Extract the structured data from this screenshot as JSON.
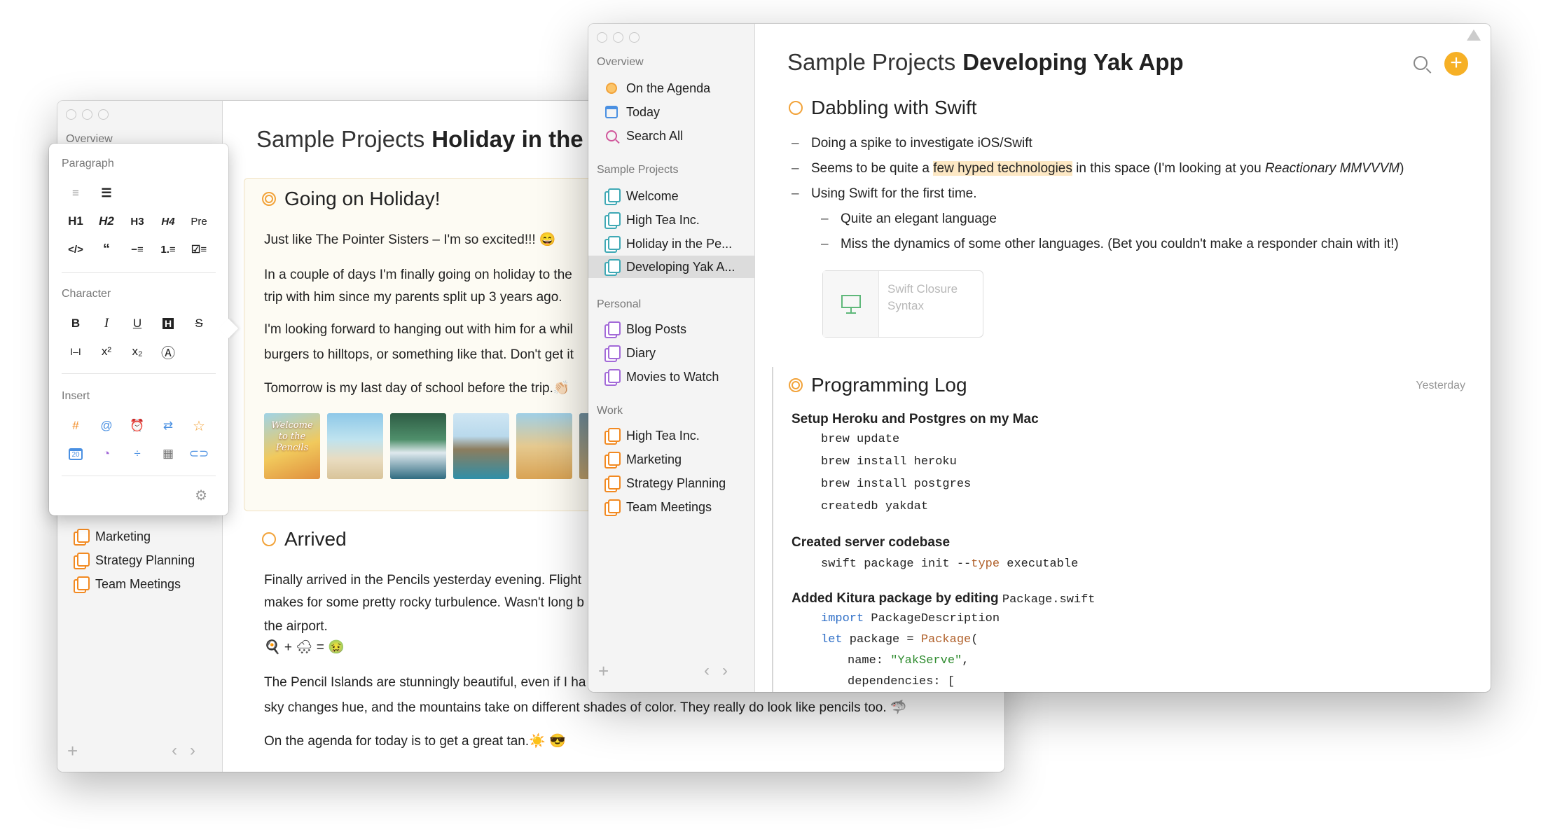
{
  "back_window": {
    "sidebar": {
      "overview_label": "Overview",
      "items": [
        {
          "label": "Marketing"
        },
        {
          "label": "Strategy Planning"
        },
        {
          "label": "Team Meetings"
        }
      ]
    },
    "title": {
      "light": "Sample Projects",
      "bold": "Holiday in the Pencil"
    },
    "sections": [
      {
        "heading": "Going on Holiday!",
        "paragraphs": [
          "Just like The Pointer Sisters – I'm so excited!!! 😄",
          "In a couple of days I'm finally going on holiday to the",
          "trip with him since my parents split up 3 years ago.",
          "I'm looking forward to hanging out with him for a whil",
          "burgers to hilltops, or something like that. Don't get it",
          "Tomorrow is my last day of school before the trip.👏🏻"
        ]
      },
      {
        "heading": "Arrived",
        "paragraphs": [
          "Finally arrived in the Pencils yesterday evening. Flight",
          "makes for some pretty rocky turbulence. Wasn't long b",
          "the airport.",
          "🍳 + 🌨 = 🤢",
          "The Pencil Islands are stunningly beautiful, even if I ha",
          "sky changes hue, and the mountains take on different shades of color. They really do look like pencils too. 🦈",
          "On the agenda for today is to get a great tan.☀️ 😎"
        ]
      }
    ],
    "photo_caption": "Welcome to the Pencils"
  },
  "format_popover": {
    "paragraph_label": "Paragraph",
    "paragraph_row1": [
      "≡",
      "☰"
    ],
    "paragraph_row2": [
      "H1",
      "H2",
      "H3",
      "H4",
      "Pre"
    ],
    "paragraph_row3": [
      "</>",
      "“",
      "−≡",
      "1.≡",
      "☑≡"
    ],
    "character_label": "Character",
    "character_row1": [
      "B",
      "I",
      "U",
      "H",
      "S"
    ],
    "character_row2": [
      "I–I",
      "x²",
      "x₂",
      "Ⓐ"
    ],
    "insert_label": "Insert",
    "insert_row1": [
      "#",
      "@",
      "⏰",
      "⇄",
      "☆"
    ],
    "insert_row2": [
      "20",
      "◔",
      "÷",
      "▦",
      "⊂⊃"
    ]
  },
  "front_window": {
    "sidebar": {
      "overview_label": "Overview",
      "overview_items": [
        "On the Agenda",
        "Today",
        "Search All"
      ],
      "sample_label": "Sample Projects",
      "sample_items": [
        "Welcome",
        "High Tea Inc.",
        "Holiday in the Pe...",
        "Developing Yak A..."
      ],
      "personal_label": "Personal",
      "personal_items": [
        "Blog Posts",
        "Diary",
        "Movies to Watch"
      ],
      "work_label": "Work",
      "work_items": [
        "High Tea Inc.",
        "Marketing",
        "Strategy Planning",
        "Team Meetings"
      ]
    },
    "title": {
      "light": "Sample Projects",
      "bold": "Developing Yak App"
    },
    "dabbling": {
      "heading": "Dabbling with Swift",
      "b1": "Doing a spike to investigate iOS/Swift",
      "b2_pre": "Seems to be quite a ",
      "b2_hl": "few hyped technologies",
      "b2_post": " in this space (I'm looking at you ",
      "b2_em": "Reactionary MMVVVM",
      "b2_end": ")",
      "b3": "Using Swift for the first time.",
      "b3a": "Quite an elegant language",
      "b3b": "Miss the dynamics of some other languages. (Bet you couldn't make a responder chain with it!)",
      "card_line1": "Swift Closure",
      "card_line2": "Syntax"
    },
    "log": {
      "heading": "Programming Log",
      "date": "Yesterday",
      "s1": "Setup Heroku and Postgres on my Mac",
      "s1_code": [
        "brew update",
        "brew install heroku",
        "brew install postgres",
        "createdb yakdat"
      ],
      "s2": "Created server codebase",
      "s2_code_pre": "swift package init --",
      "s2_code_type": "type",
      "s2_code_post": " executable",
      "s3_pre": "Added Kitura package by editing ",
      "s3_code": "Package.swift",
      "c1_kw": "import",
      "c1_rest": " PackageDescription",
      "c2_kw": "let",
      "c2_mid": " package = ",
      "c2_typ": "Package",
      "c2_end": "(",
      "c3_pre": "name: ",
      "c3_str": "\"YakServe\"",
      "c3_end": ",",
      "c4": "dependencies: ["
    }
  }
}
